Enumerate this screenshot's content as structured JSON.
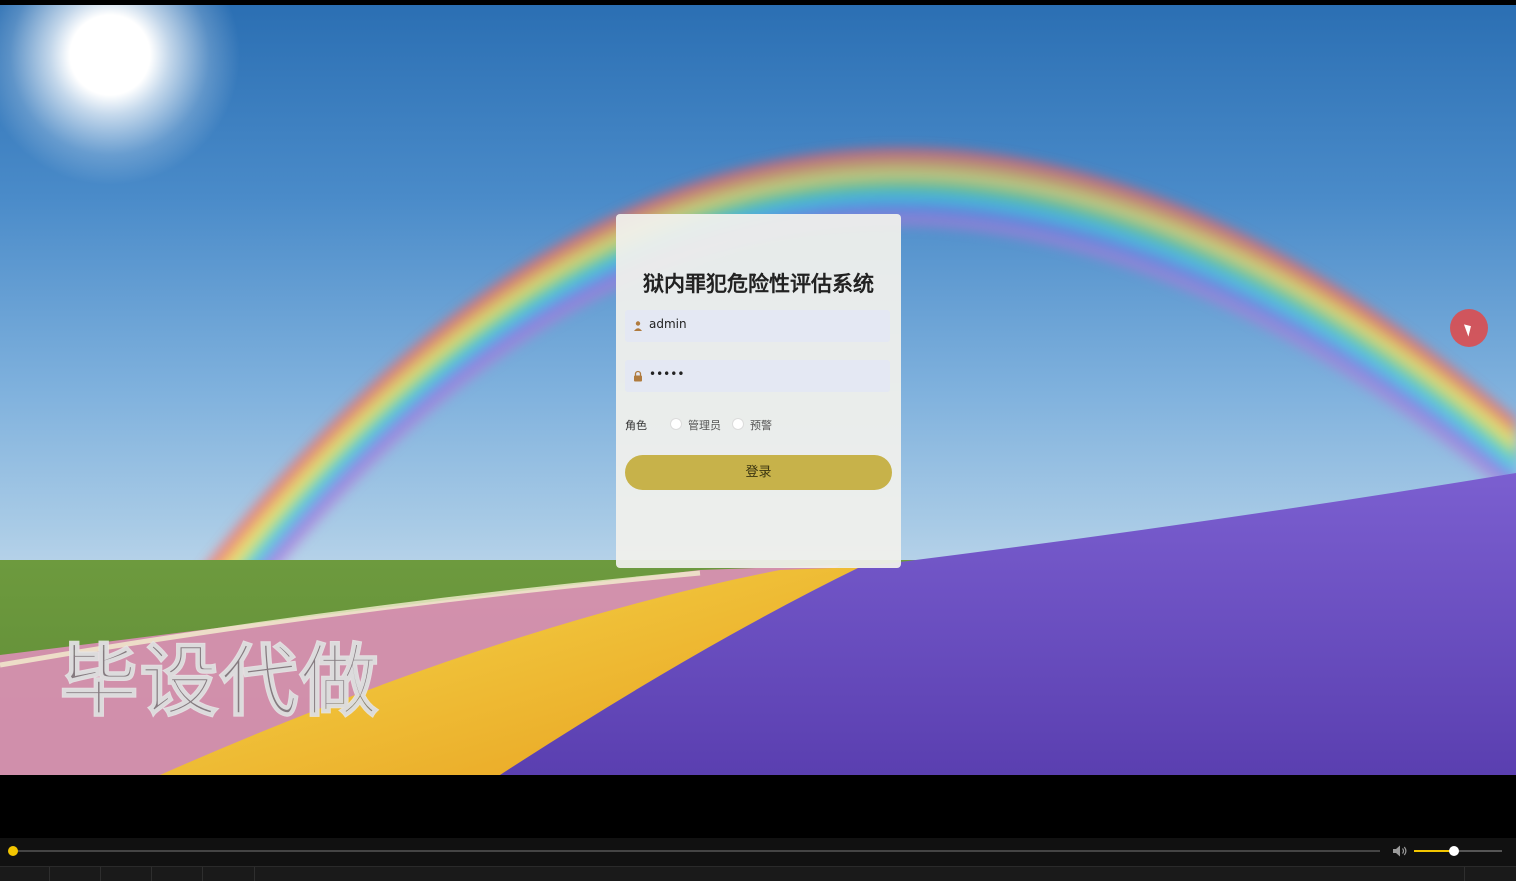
{
  "login": {
    "title": "狱内罪犯危险性评估系统",
    "username_value": "admin",
    "password_value": "•••••",
    "role_label": "角色",
    "role_options": [
      "管理员",
      "预警"
    ],
    "submit_label": "登录"
  },
  "watermark": {
    "text": "毕设代做"
  },
  "player": {
    "progress_fraction": 0.0,
    "volume_fraction": 0.45
  },
  "icons": {
    "username": "user-icon",
    "password": "lock-icon",
    "volume": "speaker-icon"
  },
  "colors": {
    "button": "#c7b24a",
    "accent": "#f2c500",
    "cursor_highlight": "#e24848"
  }
}
